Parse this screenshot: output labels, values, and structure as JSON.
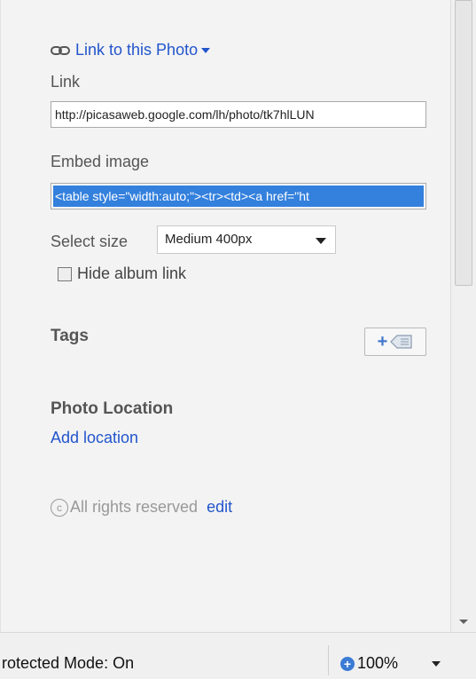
{
  "share": {
    "link_to_photo": "Link to this Photo",
    "link_label": "Link",
    "link_value": "http://picasaweb.google.com/lh/photo/tk7hlLUN",
    "embed_label": "Embed image",
    "embed_value": "<table style=\"width:auto;\"><tr><td><a href=\"ht",
    "select_size_label": "Select size",
    "select_size_value": "Medium 400px",
    "hide_album_link": "Hide album link"
  },
  "tags": {
    "heading": "Tags"
  },
  "location": {
    "heading": "Photo Location",
    "add_link": "Add location"
  },
  "license": {
    "text": "All rights reserved",
    "edit": "edit"
  },
  "statusbar": {
    "mode": "rotected Mode: On",
    "zoom": "100%"
  },
  "colors": {
    "link": "#2255cc",
    "selection": "#3380dd"
  }
}
